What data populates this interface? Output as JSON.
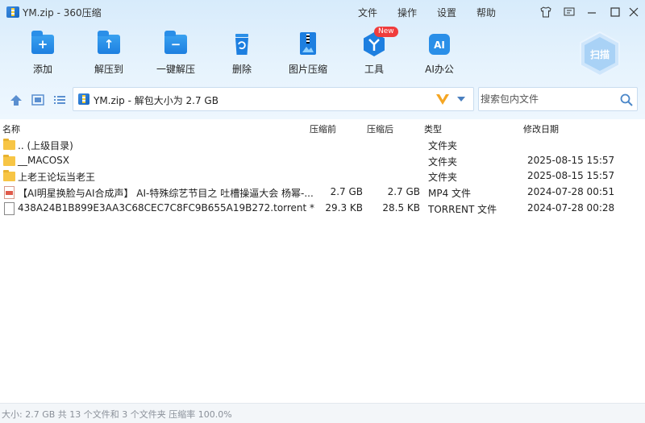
{
  "window": {
    "title": "YM.zip - 360压缩",
    "menus": [
      "文件",
      "操作",
      "设置",
      "帮助"
    ]
  },
  "toolbar": {
    "items": [
      {
        "label": "添加",
        "icon": "add-icon"
      },
      {
        "label": "解压到",
        "icon": "extract-to-icon"
      },
      {
        "label": "一键解压",
        "icon": "one-click-extract-icon"
      },
      {
        "label": "删除",
        "icon": "delete-icon"
      },
      {
        "label": "图片压缩",
        "icon": "image-compress-icon"
      },
      {
        "label": "工具",
        "icon": "tools-icon"
      },
      {
        "label": "AI办公",
        "icon": "ai-office-icon"
      }
    ],
    "new_badge": "New",
    "ai_glyph": "AI",
    "scan_label": "扫描"
  },
  "address": {
    "path": "YM.zip - 解包大小为 2.7 GB",
    "search_placeholder": "搜索包内文件"
  },
  "columns": {
    "name": "名称",
    "compressed_before": "压缩前",
    "compressed_after": "压缩后",
    "type": "类型",
    "modified": "修改日期"
  },
  "files": [
    {
      "name": ".. (上级目录)",
      "before": "",
      "after": "",
      "type": "文件夹",
      "date": "",
      "icon": "folder-icon"
    },
    {
      "name": "__MACOSX",
      "before": "",
      "after": "",
      "type": "文件夹",
      "date": "2025-08-15 15:57",
      "icon": "folder-icon"
    },
    {
      "name": "上老王论坛当老王",
      "before": "",
      "after": "",
      "type": "文件夹",
      "date": "2025-08-15 15:57",
      "icon": "folder-icon"
    },
    {
      "name": "【AI明星换脸与AI合成声】 AI-特殊综艺节目之 吐槽操逼大会 杨幂-...",
      "before": "2.7 GB",
      "after": "2.7 GB",
      "type": "MP4 文件",
      "date": "2024-07-28 00:51",
      "icon": "mp4-file-icon"
    },
    {
      "name": "438A24B1B899E3AA3C68CEC7C8FC9B655A19B272.torrent *",
      "before": "29.3 KB",
      "after": "28.5 KB",
      "type": "TORRENT 文件",
      "date": "2024-07-28 00:28",
      "icon": "file-icon"
    }
  ],
  "status": {
    "text": "大小: 2.7 GB 共 13 个文件和 3 个文件夹 压缩率 100.0%"
  },
  "colors": {
    "accent": "#1d7fe0",
    "badge": "#f03c3c",
    "folder": "#f7c545",
    "vee": "#f5a623"
  }
}
